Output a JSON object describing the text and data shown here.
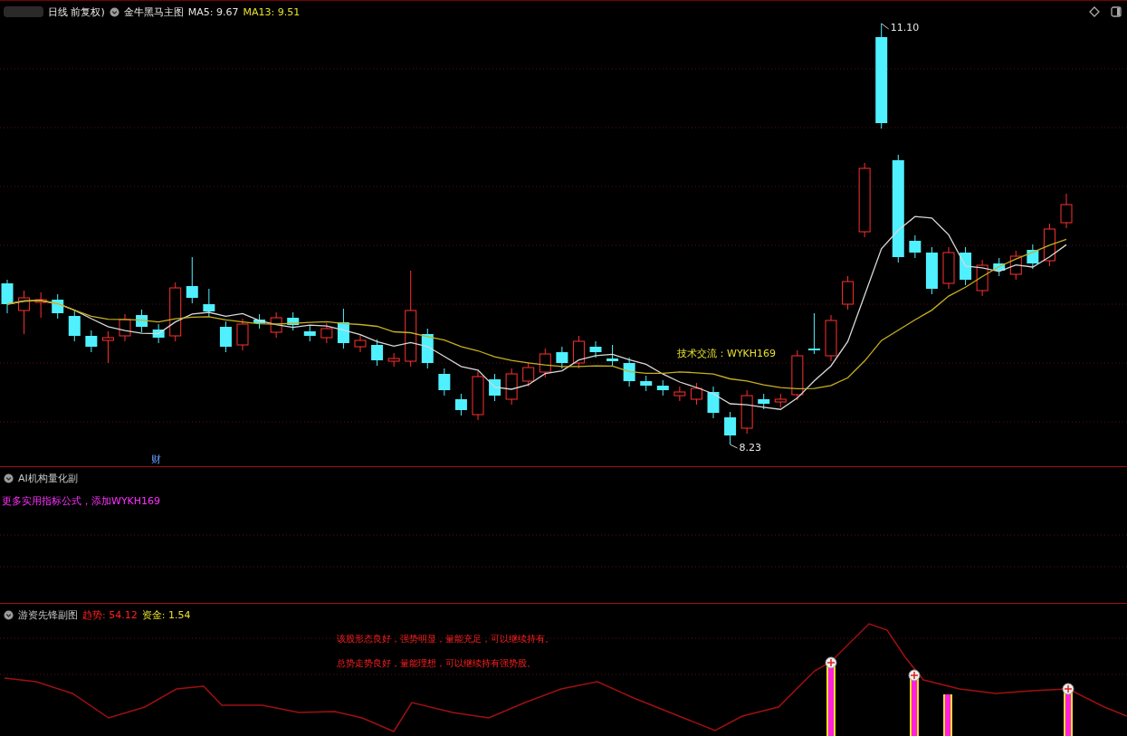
{
  "main_panel": {
    "period": "日线 前复权)",
    "indicator": "金牛黑马主图",
    "ma5": {
      "label": "MA5:",
      "value": "9.67"
    },
    "ma13": {
      "label": "MA13:",
      "value": "9.51"
    },
    "high_label": "11.10",
    "low_label": "8.23",
    "annotation": "技术交流：WYKH169",
    "marker": "财"
  },
  "sub_panel_1": {
    "title": "AI机构量化副",
    "message": "更多实用指标公式，添加WYKH169"
  },
  "sub_panel_2": {
    "title": "游资先锋副图",
    "trend": {
      "label": "趋势:",
      "value": "54.12"
    },
    "fund": {
      "label": "资金:",
      "value": "1.54"
    },
    "messages": [
      "该股形态良好，强势明显，量能充足，可以继续持有。",
      "总势走势良好，量能理想，可以继续持有强势股。"
    ]
  }
}
